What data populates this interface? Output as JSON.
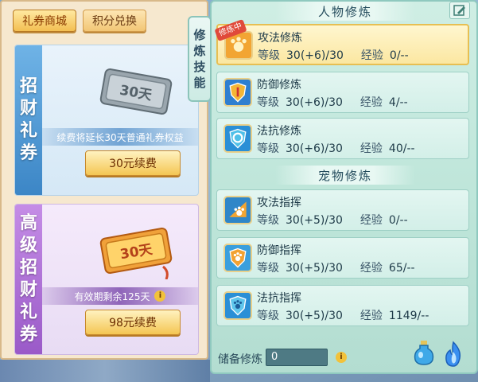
{
  "shop": {
    "tabs": [
      {
        "label": "礼券商城",
        "active": true
      },
      {
        "label": "积分兑换",
        "active": false
      }
    ],
    "cards": [
      {
        "side_chars": [
          "招",
          "财",
          "礼",
          "券"
        ],
        "ticket_text": "30天",
        "note": "续费将延长30天普通礼券权益",
        "button": "30元续费"
      },
      {
        "side_chars": [
          "高",
          "级",
          "招",
          "财",
          "礼",
          "券"
        ],
        "ticket_text": "30天",
        "note": "有效期剩余125天",
        "info_icon": "i",
        "button": "98元续费"
      }
    ]
  },
  "panel": {
    "vertical_tab": [
      "修",
      "炼",
      "技",
      "能"
    ],
    "sections": [
      {
        "title": "人物修炼",
        "skills": [
          {
            "name": "攻法修炼",
            "level_label": "等级",
            "level": "30(+6)/30",
            "exp_label": "经验",
            "exp": "0/--",
            "badge": "修炼中",
            "selected": true,
            "icon": "paw-attack-icon"
          },
          {
            "name": "防御修炼",
            "level_label": "等级",
            "level": "30(+6)/30",
            "exp_label": "经验",
            "exp": "4/--",
            "selected": false,
            "icon": "shield-icon"
          },
          {
            "name": "法抗修炼",
            "level_label": "等级",
            "level": "30(+6)/30",
            "exp_label": "经验",
            "exp": "40/--",
            "selected": false,
            "icon": "magic-resist-icon"
          }
        ]
      },
      {
        "title": "宠物修炼",
        "skills": [
          {
            "name": "攻法指挥",
            "level_label": "等级",
            "level": "30(+5)/30",
            "exp_label": "经验",
            "exp": "0/--",
            "selected": false,
            "icon": "pet-attack-icon"
          },
          {
            "name": "防御指挥",
            "level_label": "等级",
            "level": "30(+5)/30",
            "exp_label": "经验",
            "exp": "65/--",
            "selected": false,
            "icon": "pet-defense-icon"
          },
          {
            "name": "法抗指挥",
            "level_label": "等级",
            "level": "30(+5)/30",
            "exp_label": "经验",
            "exp": "1149/--",
            "selected": false,
            "icon": "pet-resist-icon"
          }
        ]
      }
    ],
    "footer": {
      "reserve_label": "储备修炼",
      "reserve_value": "0",
      "info_icon": "i"
    }
  }
}
